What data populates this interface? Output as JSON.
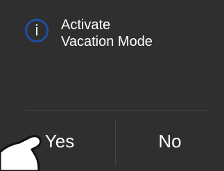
{
  "dialog": {
    "icon": "info-icon",
    "icon_glyph": "i",
    "icon_color": "#1f4fa8",
    "message_line1": "Activate",
    "message_line2": "Vacation Mode",
    "yes_label": "Yes",
    "no_label": "No"
  },
  "colors": {
    "background": "#2f2f2f",
    "text": "#ffffff",
    "divider": "#454545"
  }
}
